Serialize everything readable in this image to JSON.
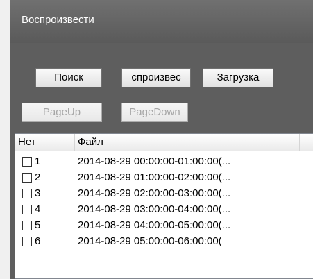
{
  "window": {
    "title": "Воспроизвести"
  },
  "buttons": {
    "search": "Поиск",
    "play": "спроизвес",
    "download": "Загрузка",
    "page_up": "PageUp",
    "page_down": "PageDown"
  },
  "list": {
    "columns": [
      "Нет",
      "Файл"
    ],
    "rows": [
      {
        "num": "1",
        "file": "2014-08-29 00:00:00-01:00:00(..."
      },
      {
        "num": "2",
        "file": "2014-08-29 01:00:00-02:00:00(..."
      },
      {
        "num": "3",
        "file": "2014-08-29 02:00:00-03:00:00(..."
      },
      {
        "num": "4",
        "file": "2014-08-29 03:00:00-04:00:00(..."
      },
      {
        "num": "5",
        "file": "2014-08-29 04:00:00-05:00:00(..."
      },
      {
        "num": "6",
        "file": "2014-08-29 05:00:00-06:00:00("
      }
    ]
  }
}
